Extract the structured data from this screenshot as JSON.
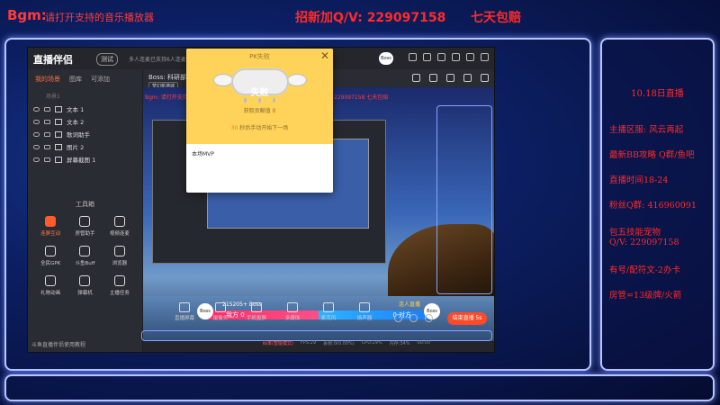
{
  "overlay": {
    "bgm_label": "Bgm:",
    "bgm_text": "请打开支持的音乐播放器",
    "recruit": "招新加Q/V: 229097158",
    "refund": "七天包赔"
  },
  "app": {
    "logo": "直播伴侣",
    "version": "测试",
    "title_info": "多人连麦已支持6人连麦 开启...",
    "boss_chip": "Boss",
    "sidebar_tabs": [
      "我的场景",
      "图库",
      "可添加"
    ],
    "scene_label": "场景1",
    "sources": [
      {
        "name": "文本 1"
      },
      {
        "name": "文本 2"
      },
      {
        "name": "歌词助手"
      },
      {
        "name": "图片 2"
      },
      {
        "name": "屏幕截图 1"
      }
    ],
    "tools_title": "工具箱",
    "tools": [
      {
        "label": "连屏互动",
        "hot": true
      },
      {
        "label": "房管助手",
        "hot": false
      },
      {
        "label": "视频连麦",
        "hot": false
      },
      {
        "label": "全民GPK",
        "hot": false
      },
      {
        "label": "斗鱼Buff",
        "hot": false
      },
      {
        "label": "浏览器",
        "hot": false
      },
      {
        "label": "礼物动画",
        "hot": false
      },
      {
        "label": "弹幕机",
        "hot": false
      },
      {
        "label": "主播任务",
        "hot": false
      }
    ],
    "sidebar_footer": "斗鱼直播伴侣使用教程",
    "boss_name": "Boss: 科研部",
    "dream_tag": "梦幻新港城",
    "marquee_left": "Bgm: 请打开支持的音乐播放器",
    "marquee_right": "229097158  七天包赔",
    "pk_score": "215205+ Boss",
    "pk_me": "我方 0",
    "pk_opp": "0 对方",
    "pk_avatar_left": "Boss",
    "pk_avatar_right": "Boss",
    "pk_crown": "连人直播",
    "controls": [
      "直播屏幕",
      "摄像头",
      "手机投屏",
      "多媒体",
      "麦克风",
      "扬声器"
    ],
    "status": [
      "码率(智能模式)",
      "FPS:29",
      "丢帧:0(0.00%)",
      "CPU:29%",
      "内存:34%",
      "00:00"
    ],
    "live_button": "结束直播 5s"
  },
  "pk_modal": {
    "title": "PK失败",
    "close": "✕",
    "fail_text": "失败",
    "contribution": "获取贡献值 0",
    "countdown_num": "30",
    "countdown_text": " 秒后手动开始下一场",
    "mvp": "本场MVP"
  },
  "right_panel": {
    "heading": "10.18日直播",
    "lines": [
      "主播区服: 风云再起",
      "最新BB攻略 Q群/鱼吧",
      "直播时间18-24",
      "粉丝Q群: 416960091",
      "包五技能宠物",
      "Q/V: 229097158",
      "有号/配符文-2办卡",
      "房管=13级牌/火箭"
    ]
  }
}
